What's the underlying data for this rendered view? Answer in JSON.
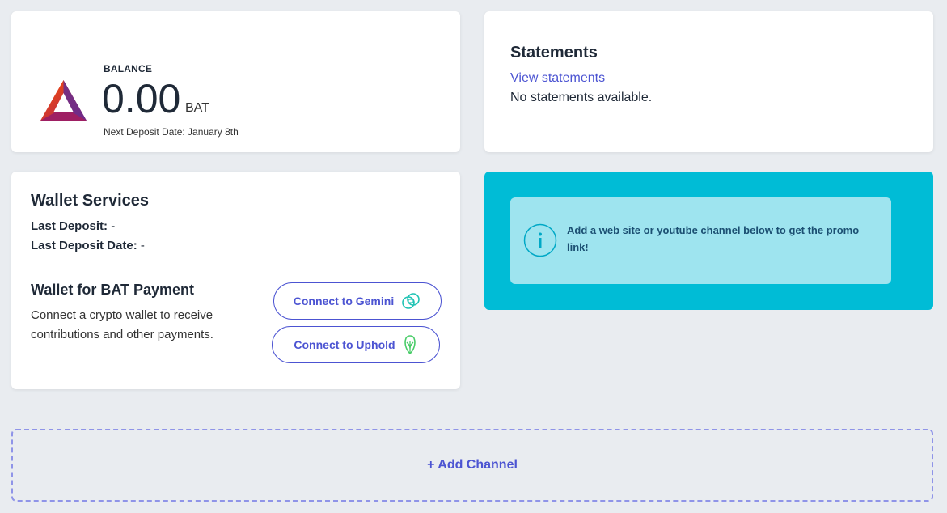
{
  "balance": {
    "label": "BALANCE",
    "amount": "0.00",
    "unit": "BAT",
    "next_deposit": "Next Deposit Date: January 8th"
  },
  "statements": {
    "title": "Statements",
    "link": "View statements",
    "empty": "No statements available."
  },
  "wallet": {
    "title": "Wallet Services",
    "last_deposit_label": "Last Deposit:",
    "last_deposit_value": "-",
    "last_deposit_date_label": "Last Deposit Date:",
    "last_deposit_date_value": "-",
    "payment_title": "Wallet for BAT Payment",
    "payment_desc": "Connect a crypto wallet to receive contributions and other payments.",
    "gemini_label": "Connect to Gemini",
    "uphold_label": "Connect to Uphold",
    "gemini_icon": "gemini-icon",
    "uphold_icon": "uphold-icon"
  },
  "promo": {
    "text": "Add a web site or youtube channel below to get the promo link!",
    "icon": "info-icon"
  },
  "add_channel": {
    "label": "+ Add Channel"
  },
  "colors": {
    "accent": "#4c54d2",
    "promo_bg": "#00bcd6",
    "promo_inner": "#9ee4ef"
  }
}
